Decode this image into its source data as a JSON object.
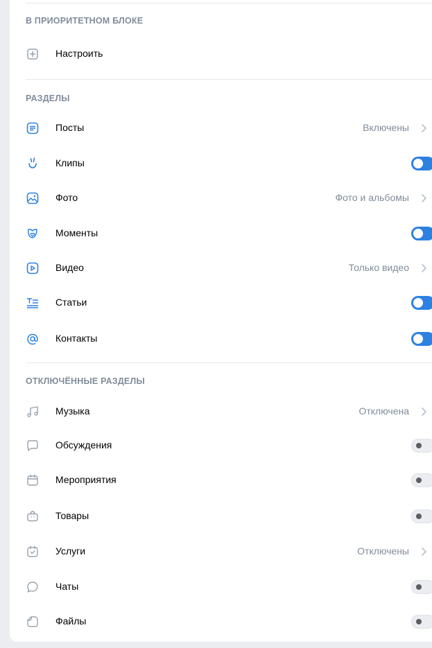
{
  "sections": {
    "priority": {
      "header": "В ПРИОРИТЕТНОМ БЛОКЕ",
      "configure_label": "Настроить"
    },
    "main": {
      "header": "РАЗДЕЛЫ",
      "items": [
        {
          "label": "Посты",
          "value": "Включены",
          "icon": "posts-icon"
        },
        {
          "label": "Клипы",
          "toggle": true,
          "icon": "clips-icon"
        },
        {
          "label": "Фото",
          "value": "Фото и альбомы",
          "icon": "photo-icon"
        },
        {
          "label": "Моменты",
          "toggle": true,
          "icon": "moments-icon"
        },
        {
          "label": "Видео",
          "value": "Только видео",
          "icon": "video-icon"
        },
        {
          "label": "Статьи",
          "toggle": true,
          "icon": "articles-icon"
        },
        {
          "label": "Контакты",
          "toggle": true,
          "icon": "contacts-icon"
        }
      ]
    },
    "disabled": {
      "header": "ОТКЛЮЧЁННЫЕ РАЗДЕЛЫ",
      "items": [
        {
          "label": "Музыка",
          "value": "Отключена",
          "icon": "music-icon"
        },
        {
          "label": "Обсуждения",
          "toggle": false,
          "icon": "discussions-icon"
        },
        {
          "label": "Мероприятия",
          "toggle": false,
          "icon": "events-icon"
        },
        {
          "label": "Товары",
          "toggle": false,
          "icon": "goods-icon"
        },
        {
          "label": "Услуги",
          "value": "Отключены",
          "icon": "services-icon"
        },
        {
          "label": "Чаты",
          "toggle": false,
          "icon": "chats-icon"
        },
        {
          "label": "Файлы",
          "toggle": false,
          "icon": "files-icon"
        }
      ]
    }
  },
  "colors": {
    "accent": "#2d81e0",
    "icon_active": "#2d81e0",
    "icon_inactive": "#99a2ad",
    "secondary_text": "#818c99"
  }
}
